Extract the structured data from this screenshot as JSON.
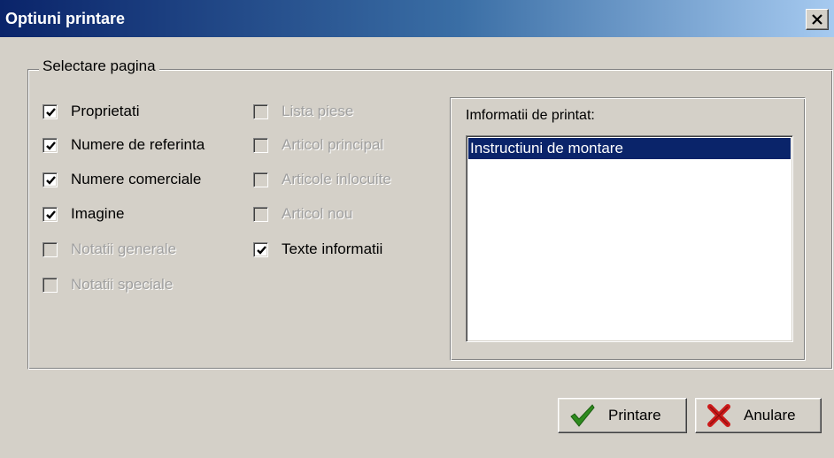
{
  "window": {
    "title": "Optiuni printare",
    "close_glyph": "×"
  },
  "group": {
    "legend": "Selectare pagina",
    "col1": [
      {
        "label": "Proprietati",
        "checked": true,
        "enabled": true
      },
      {
        "label": "Numere de referinta",
        "checked": true,
        "enabled": true
      },
      {
        "label": "Numere comerciale",
        "checked": true,
        "enabled": true
      },
      {
        "label": "Imagine",
        "checked": true,
        "enabled": true
      },
      {
        "label": "Notatii generale",
        "checked": false,
        "enabled": false
      },
      {
        "label": "Notatii speciale",
        "checked": false,
        "enabled": false
      }
    ],
    "col2": [
      {
        "label": "Lista piese",
        "checked": false,
        "enabled": false
      },
      {
        "label": "Articol principal",
        "checked": false,
        "enabled": false
      },
      {
        "label": "Articole inlocuite",
        "checked": false,
        "enabled": false
      },
      {
        "label": "Articol nou",
        "checked": false,
        "enabled": false
      },
      {
        "label": "Texte informatii",
        "checked": true,
        "enabled": true
      }
    ]
  },
  "info": {
    "label": "Imformatii de printat:",
    "items": [
      {
        "text": "Instructiuni de montare",
        "selected": true
      }
    ]
  },
  "buttons": {
    "print_label": "Printare",
    "print_icon": "green-check-icon",
    "cancel_label": "Anulare",
    "cancel_icon": "red-x-icon"
  },
  "colors": {
    "selection": "#0a246a",
    "check_green": "#2e8b1e",
    "cancel_red": "#cc1a1a"
  }
}
